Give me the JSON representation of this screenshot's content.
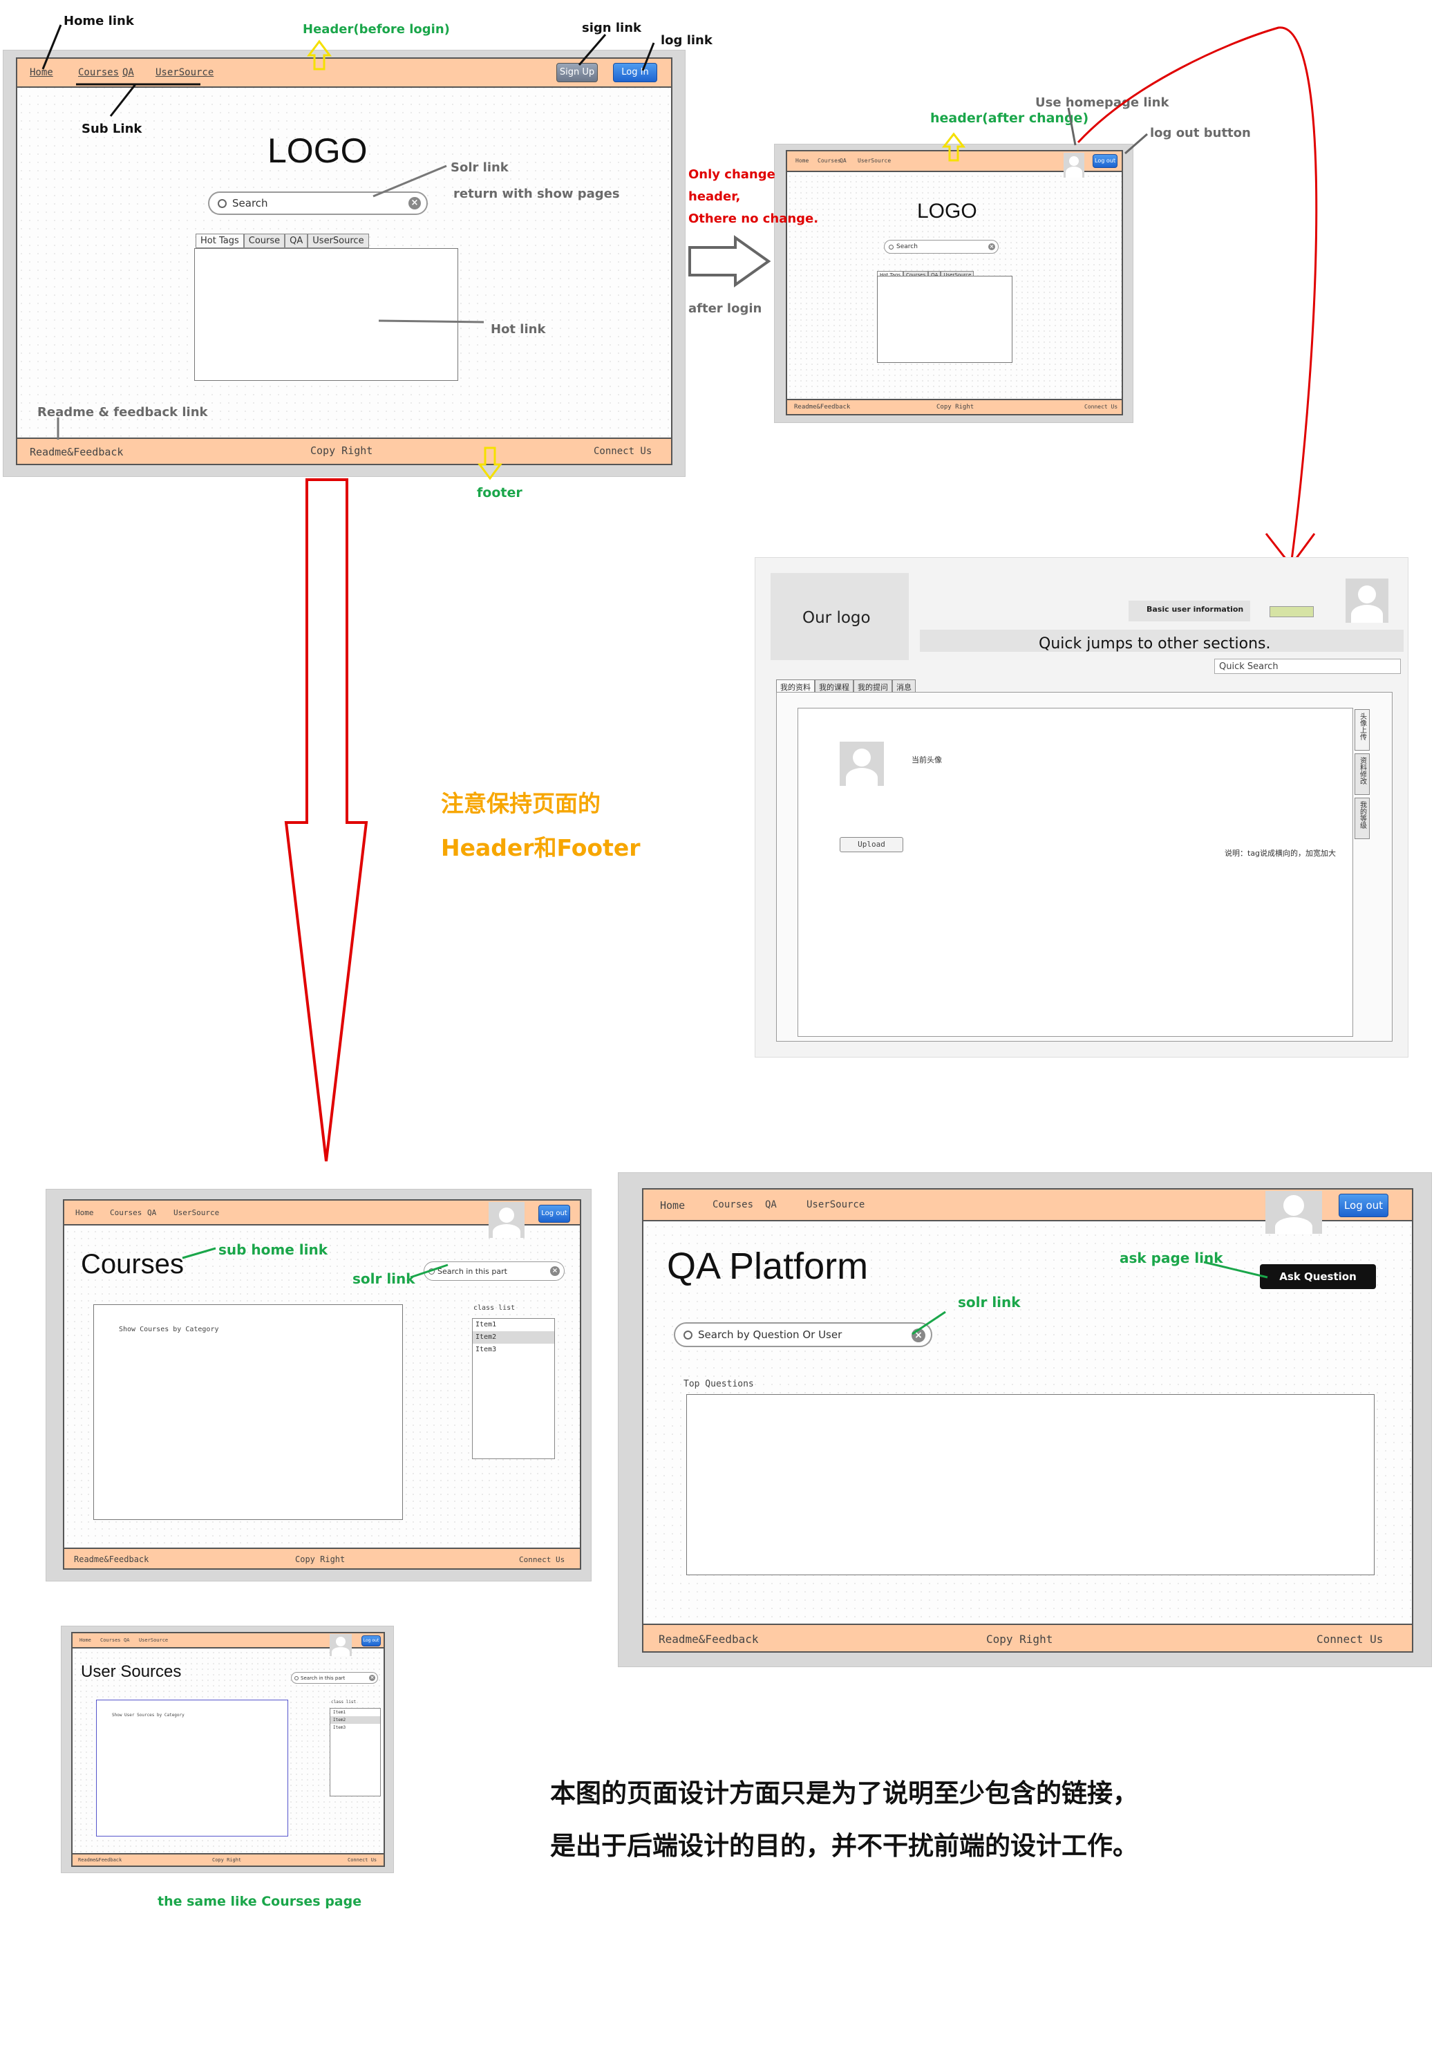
{
  "main_page": {
    "nav": [
      "Home",
      "Courses",
      "QA",
      "UserSource"
    ],
    "signup_label": "Sign Up",
    "login_label": "Log In",
    "logo": "LOGO",
    "search_placeholder": "Search",
    "tabs": [
      "Hot Tags",
      "Course",
      "QA",
      "UserSource"
    ],
    "footer": [
      "Readme&Feedback",
      "Copy Right",
      "Connect Us"
    ]
  },
  "annotations_main": {
    "home_link": "Home link",
    "header_before_login": "Header(before login)",
    "sign_link": "sign link",
    "log_link": "log link",
    "sub_link": "Sub Link",
    "solr_link": "Solr link",
    "return_show_pages": "return with show pages",
    "hot_link": "Hot link",
    "readme_feedback_link": "Readme & feedback link",
    "footer": "footer"
  },
  "after_login": {
    "nav": [
      "Home",
      "Courses",
      "QA",
      "UserSource"
    ],
    "logo": "LOGO",
    "search_placeholder": "Search",
    "tabs": [
      "Hot Tags",
      "Courses",
      "QA",
      "UserSource"
    ],
    "logout_label": "Log out",
    "footer": [
      "Readme&Feedback",
      "Copy Right",
      "Connect Us"
    ],
    "note_only_change": "Only change",
    "note_header": "header,",
    "note_others": "Othere no change.",
    "note_after_login": "after login",
    "note_use_homepage": "Use homepage link",
    "note_header_after": "header(after change)",
    "note_logout_button": "log out button"
  },
  "user_page": {
    "our_logo": "Our logo",
    "basic_info": "Basic user information",
    "quick_jumps": "Quick jumps to other sections.",
    "quick_search": "Quick Search",
    "tabs": [
      "我的资料",
      "我的课程",
      "我的提问",
      "消息"
    ],
    "current_avatar": "当前头像",
    "upload_label": "Upload",
    "side_tabs": [
      "头像上传",
      "资料修改",
      "我的等级"
    ],
    "side_note": "说明：tag说成横向的，加宽加大"
  },
  "center_note": {
    "line1": "注意保持页面的",
    "line2": "Header和Footer"
  },
  "courses_page": {
    "nav": [
      "Home",
      "Courses",
      "QA",
      "UserSource"
    ],
    "logout_label": "Log out",
    "title": "Courses",
    "sub_home_link": "sub home link",
    "solr_link": "solr link",
    "search_placeholder": "Search in this part",
    "show_courses": "Show Courses by Category",
    "class_list": "class list",
    "items": [
      "Item1",
      "Item2",
      "Item3"
    ],
    "footer": [
      "Readme&Feedback",
      "Copy Right",
      "Connect Us"
    ]
  },
  "qa_page": {
    "nav": [
      "Home",
      "Courses",
      "QA",
      "UserSource"
    ],
    "logout_label": "Log out",
    "title": "QA Platform",
    "ask_page_link": "ask page link",
    "ask_button": "Ask Question",
    "solr_link": "solr link",
    "search_placeholder": "Search by Question Or User",
    "top_questions": "Top Questions",
    "footer": [
      "Readme&Feedback",
      "Copy Right",
      "Connect Us"
    ]
  },
  "usersources_page": {
    "nav": [
      "Home",
      "Courses",
      "QA",
      "UserSource"
    ],
    "logout_label": "Log out",
    "title": "User Sources",
    "search_placeholder": "Search in this part",
    "show_sources": "Show User Sources by Category",
    "class_list": "class list",
    "items": [
      "Item1",
      "Item2",
      "Item3"
    ],
    "footer": [
      "Readme&Feedback",
      "Copy Right",
      "Connect Us"
    ],
    "caption": "the same like Courses page"
  },
  "bottom_note": {
    "line1": "本图的页面设计方面只是为了说明至少包含的链接，",
    "line2": "是出于后端设计的目的，并不干扰前端的设计工作。"
  },
  "colors": {
    "header_footer": "#ffcba4",
    "green_note": "#1aa64a",
    "red_note": "#e00000",
    "orange_note": "#f7a600",
    "arrow_red": "#e00000",
    "arrow_yellow": "#f5e000"
  }
}
